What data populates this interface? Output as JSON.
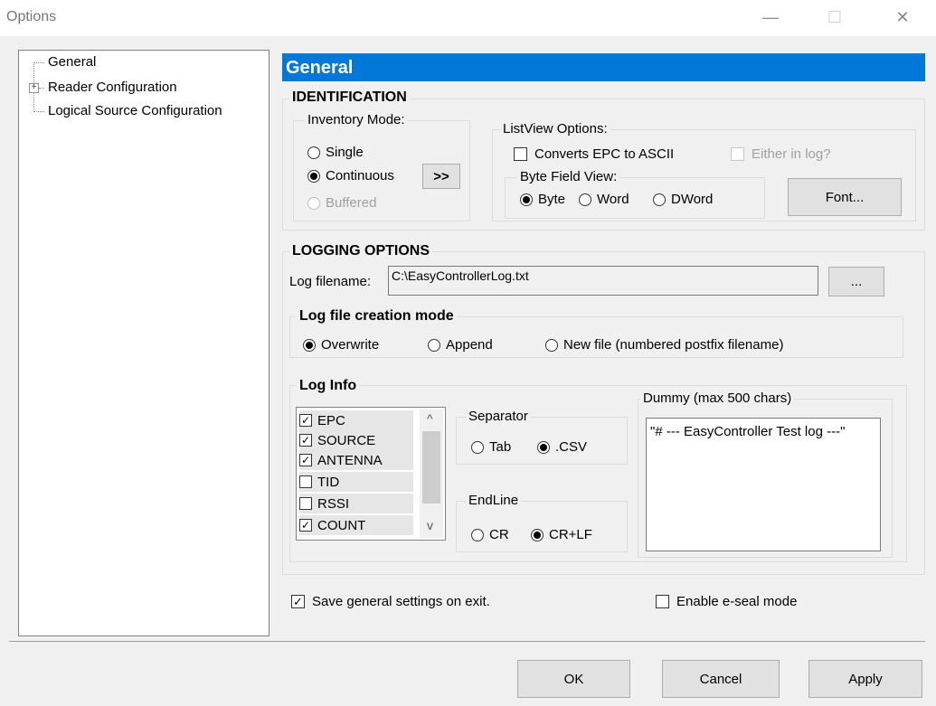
{
  "window": {
    "title": "Options",
    "minimize": "—",
    "maximize": "☐",
    "close": "✕"
  },
  "tree": {
    "items": [
      "General",
      "Reader Configuration",
      "Logical Source Configuration"
    ],
    "expander": "+"
  },
  "panel": {
    "title": "General"
  },
  "identification": {
    "title": "IDENTIFICATION",
    "inventory_mode": {
      "label": "Inventory Mode:",
      "single": "Single",
      "continuous": "Continuous",
      "buffered": "Buffered",
      "selected": "Continuous",
      "more_button": ">>"
    },
    "listview": {
      "label": "ListView Options:",
      "convert_epc": "Converts EPC to ASCII",
      "either_in_log": "Either in log?",
      "byte_field_view": "Byte Field View:",
      "byte": "Byte",
      "word": "Word",
      "dword": "DWord",
      "selected": "Byte",
      "font_button": "Font..."
    }
  },
  "logging": {
    "title": "LOGGING OPTIONS",
    "filename_label": "Log filename:",
    "filename_value": "C:\\EasyControllerLog.txt",
    "browse_button": "...",
    "creation_mode": {
      "title": "Log file creation mode",
      "overwrite": "Overwrite",
      "append": "Append",
      "new_file": "New file (numbered postfix filename)",
      "selected": "Overwrite"
    },
    "log_info": {
      "title": "Log Info",
      "fields": [
        {
          "name": "EPC",
          "checked": true
        },
        {
          "name": "SOURCE",
          "checked": true
        },
        {
          "name": "ANTENNA",
          "checked": true
        },
        {
          "name": "TID",
          "checked": false
        },
        {
          "name": "RSSI",
          "checked": false
        },
        {
          "name": "COUNT",
          "checked": true
        }
      ],
      "separator": {
        "label": "Separator",
        "tab": "Tab",
        "csv": ".CSV",
        "selected": ".CSV"
      },
      "endline": {
        "label": "EndLine",
        "cr": "CR",
        "crlf": "CR+LF",
        "selected": "CR+LF"
      },
      "dummy": {
        "label": "Dummy (max 500 chars)",
        "value": "\"# --- EasyController Test log ---\""
      }
    }
  },
  "options": {
    "save_on_exit": "Save general settings on exit.",
    "save_checked": true,
    "eseal": "Enable e-seal mode",
    "eseal_checked": false
  },
  "buttons": {
    "ok": "OK",
    "cancel": "Cancel",
    "apply": "Apply"
  },
  "check_mark": "✓",
  "scroll": {
    "up": "^",
    "down": "v"
  },
  "colors": {
    "header": "#0078d7"
  }
}
